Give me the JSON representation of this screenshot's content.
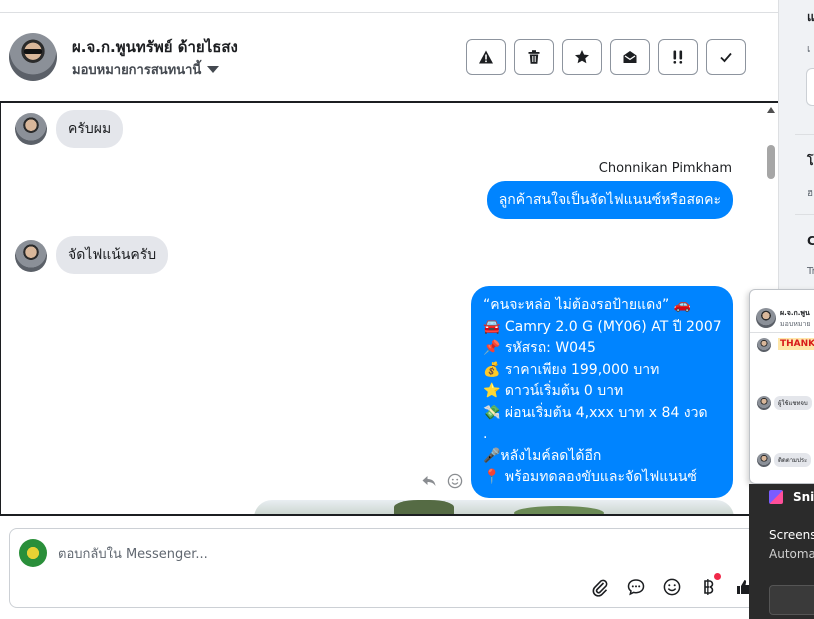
{
  "header": {
    "contact_name": "ผ.จ.ก.พูนทรัพย์ ด้ายไธสง",
    "assign_label": "มอบหมายการสนทนานี้",
    "actions": [
      {
        "name": "spam-button",
        "icon": "warning-icon"
      },
      {
        "name": "delete-button",
        "icon": "trash-icon"
      },
      {
        "name": "star-button",
        "icon": "star-icon"
      },
      {
        "name": "mark-unread-button",
        "icon": "envelope-open-icon"
      },
      {
        "name": "follow-up-button",
        "icon": "double-exclamation-icon"
      },
      {
        "name": "mark-done-button",
        "icon": "check-icon"
      }
    ]
  },
  "messages": {
    "m1": "ครับผม",
    "sender_name": "Chonnikan Pimkham",
    "m2": "ลูกค้าสนใจเป็นจัดไฟแนนซ์หรือสดคะ",
    "m3": "จัดไฟแน้นครับ",
    "m4": [
      "“คนจะหล่อ ไม่ต้องรอป้ายแดง” 🚗",
      "🚘 Camry 2.0 G (MY06) AT ปี 2007",
      "📌 รหัสรถ: W045",
      "💰 ราคาเพียง 199,000 บาท",
      "⭐ ดาวน์เริ่มต้น 0 บาท",
      "💸 ผ่อนเริ่มต้น 4,xxx บาท x 84 งวด",
      ".",
      "🎤หลังไมค์ลดได้อีก",
      "📍 พร้อมทดลองขับและจัดไฟแนนซ์"
    ]
  },
  "composer": {
    "placeholder": "ตอบกลับใน Messenger..."
  },
  "right_panel": {
    "items": [
      "แ",
      "เ",
      "โ",
      "ฮ",
      "C",
      "Tr"
    ]
  },
  "popup_chat": {
    "name": "ผ.จ.ก.พูน",
    "sub": "มอบหมาย",
    "thanks": "THANK",
    "bubble1": "ผู้ใช้แชทจบ",
    "bubble2": "ติดตามประ"
  },
  "snip_toast": {
    "title": "Snip",
    "line1": "Screens",
    "line2": "Automa"
  }
}
